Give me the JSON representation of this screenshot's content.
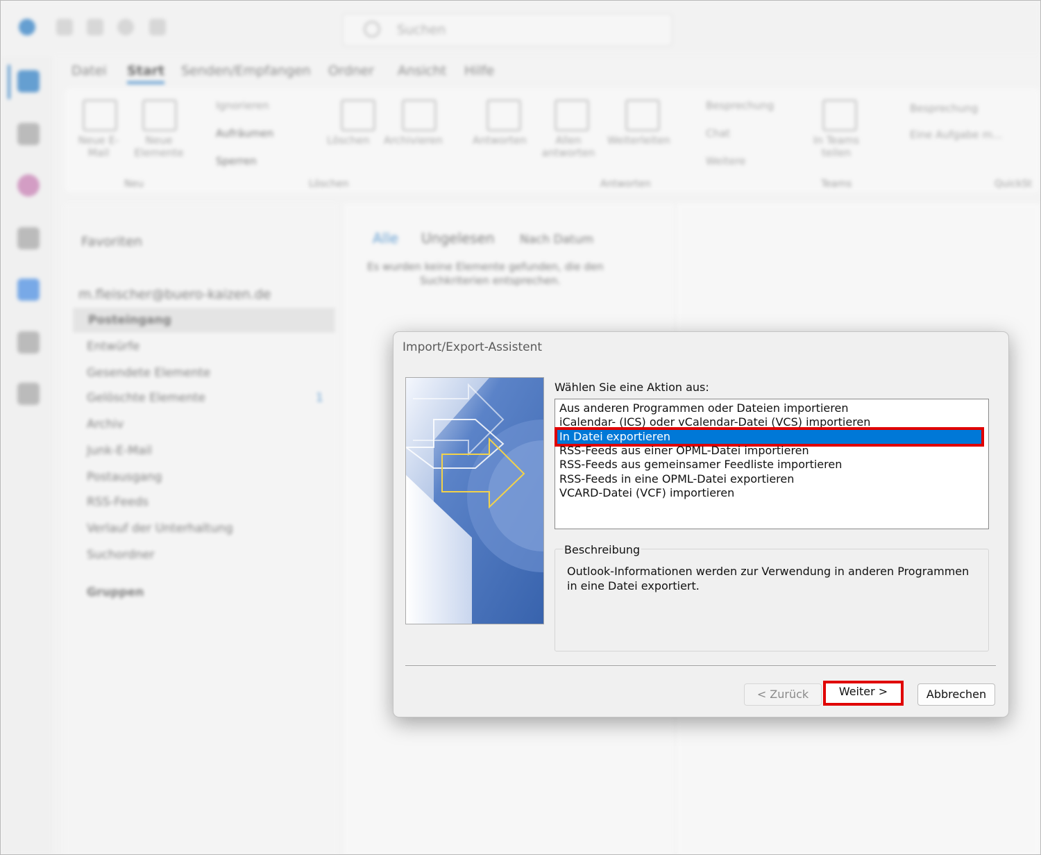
{
  "outlook_background": {
    "search_placeholder": "Suchen",
    "ribbon_tabs": [
      "Datei",
      "Start",
      "Senden/Empfangen",
      "Ordner",
      "Ansicht",
      "Hilfe"
    ],
    "ribbon": {
      "new_email": "Neue E-Mail",
      "new_items": "Neue Elemente",
      "ignore": "Ignorieren",
      "cleanup": "Aufräumen",
      "block": "Sperren",
      "delete": "Löschen",
      "archive": "Archivieren",
      "reply": "Antworten",
      "reply_all": "Allen antworten",
      "forward": "Weiterleiten",
      "meeting": "Besprechung",
      "chat": "Chat",
      "more": "Weitere",
      "share_teams": "In Teams teilen",
      "qs_meeting": "Besprechung",
      "qs_task": "Eine Aufgabe m...",
      "groups": [
        "Neu",
        "Löschen",
        "Antworten",
        "Teams",
        "QuickSt"
      ]
    },
    "folders": {
      "favorites": "Favoriten",
      "account": "m.fleischer@buero-kaizen.de",
      "items": [
        "Posteingang",
        "Entwürfe",
        "Gesendete Elemente",
        "Gelöschte Elemente",
        "Archiv",
        "Junk-E-Mail",
        "Postausgang",
        "RSS-Feeds",
        "Verlauf der Unterhaltung",
        "Suchordner"
      ],
      "deleted_count": "1",
      "groups": "Gruppen"
    },
    "message_list": {
      "tab_all": "Alle",
      "tab_unread": "Ungelesen",
      "sort": "Nach Datum",
      "empty_line1": "Es wurden keine Elemente gefunden, die den",
      "empty_line2": "Suchkriterien entsprechen."
    }
  },
  "dialog": {
    "title": "Import/Export-Assistent",
    "prompt": "Wählen Sie eine Aktion aus:",
    "actions": [
      "Aus anderen Programmen oder Dateien importieren",
      "iCalendar- (ICS) oder vCalendar-Datei (VCS) importieren",
      "In Datei exportieren",
      "RSS-Feeds aus einer OPML-Datei importieren",
      "RSS-Feeds aus gemeinsamer Feedliste importieren",
      "RSS-Feeds in eine OPML-Datei exportieren",
      "VCARD-Datei (VCF) importieren"
    ],
    "selected_action": "In Datei exportieren",
    "description_title": "Beschreibung",
    "description_line1": "Outlook-Informationen werden zur Verwendung in anderen Programmen",
    "description_line2": "in eine Datei exportiert.",
    "back_label": "< Zurück",
    "next_label": "Weiter >",
    "cancel_label": "Abbrechen"
  },
  "colors": {
    "selection": "#0078d7",
    "highlight_box": "#e00000",
    "accent": "#0f6cbd"
  }
}
